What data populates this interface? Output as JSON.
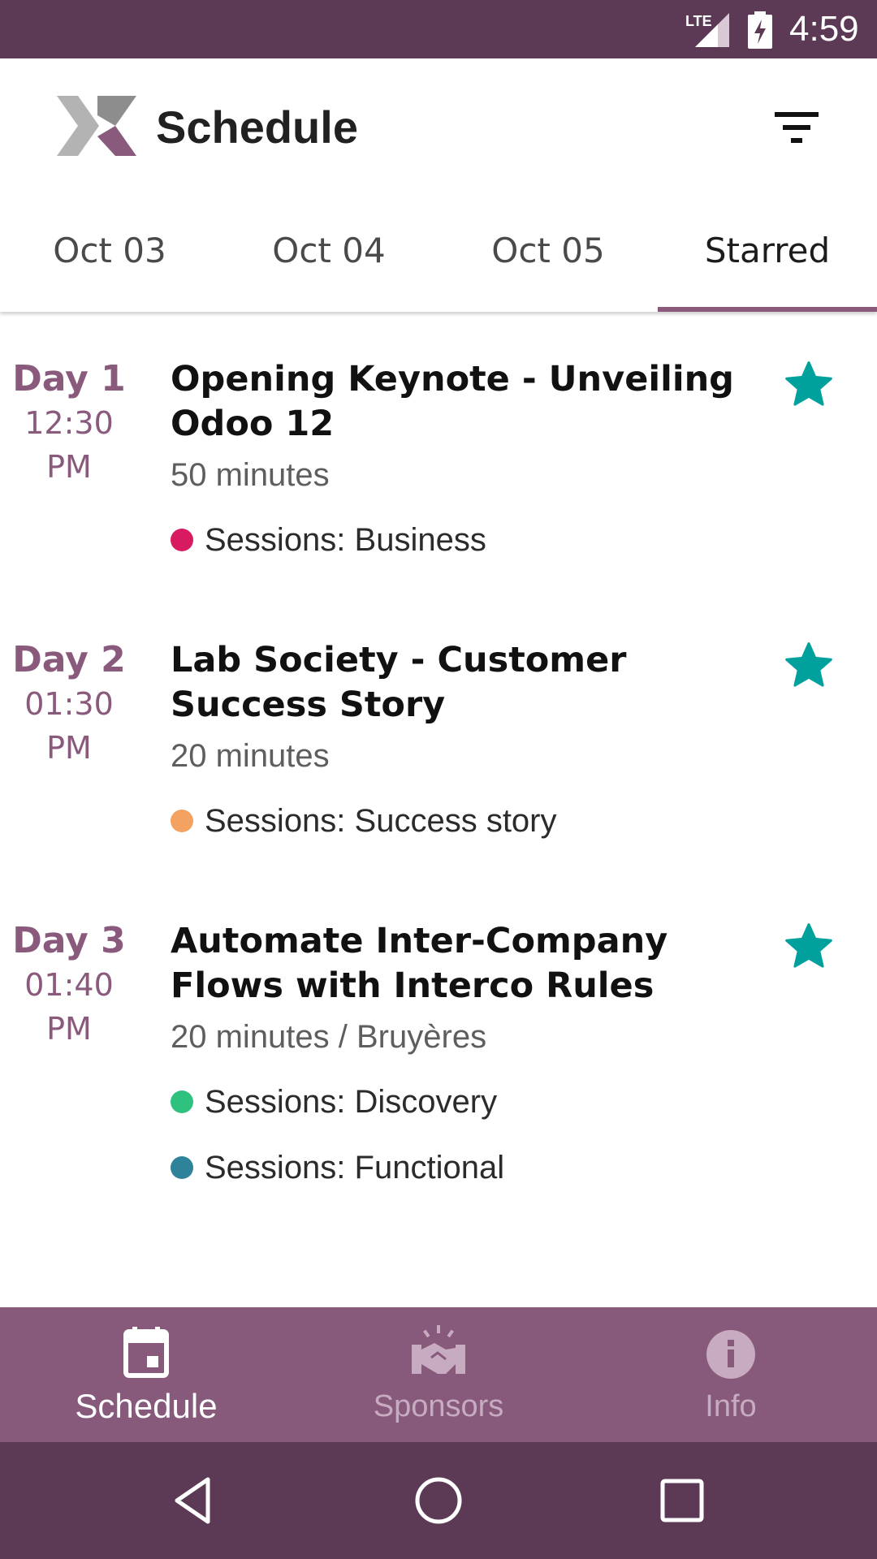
{
  "status_bar": {
    "network_label": "LTE",
    "time": "4:59",
    "icons": [
      "lte-signal-icon",
      "battery-charging-icon"
    ]
  },
  "app_bar": {
    "title": "Schedule",
    "logo_icon": "event-x-logo-icon",
    "filter_icon": "filter-icon"
  },
  "tabs": [
    {
      "label": "Oct 03",
      "active": false
    },
    {
      "label": "Oct 04",
      "active": false
    },
    {
      "label": "Oct 05",
      "active": false
    },
    {
      "label": "Starred",
      "active": true
    }
  ],
  "sessions": [
    {
      "day": "Day 1",
      "time_line1": "12:30",
      "time_line2": "PM",
      "title": "Opening Keynote - Unveiling Odoo 12",
      "meta": "50 minutes",
      "starred": true,
      "tags": [
        {
          "label": "Sessions: Business",
          "color": "#d81b60"
        }
      ]
    },
    {
      "day": "Day 2",
      "time_line1": "01:30",
      "time_line2": "PM",
      "title": "Lab Society - Customer Success Story",
      "meta": "20 minutes",
      "starred": true,
      "tags": [
        {
          "label": "Sessions: Success story",
          "color": "#f4a261"
        }
      ]
    },
    {
      "day": "Day 3",
      "time_line1": "01:40",
      "time_line2": "PM",
      "title": "Automate Inter-Company Flows with Interco Rules",
      "meta": "20 minutes / Bruyères",
      "starred": true,
      "tags": [
        {
          "label": "Sessions: Discovery",
          "color": "#2ec27e"
        },
        {
          "label": "Sessions: Functional",
          "color": "#2e8299"
        }
      ]
    }
  ],
  "bottom_nav": [
    {
      "label": "Schedule",
      "icon": "calendar-icon",
      "active": true
    },
    {
      "label": "Sponsors",
      "icon": "handshake-icon",
      "active": false
    },
    {
      "label": "Info",
      "icon": "info-icon",
      "active": false
    }
  ],
  "system_nav": {
    "icons": [
      "back-icon",
      "home-icon",
      "recents-icon"
    ]
  },
  "colors": {
    "status_bar": "#5c3a55",
    "accent": "#8a5a7d",
    "bottom_nav": "#875a7b",
    "star": "#00a09d"
  }
}
